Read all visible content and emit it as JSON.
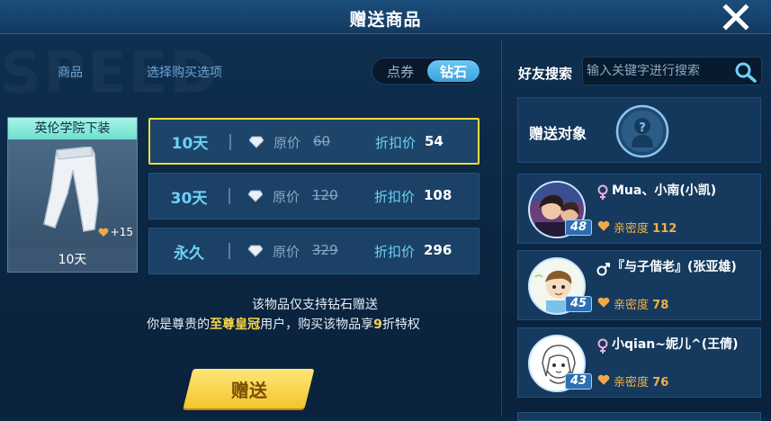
{
  "header": {
    "title": "赠送商品",
    "close_icon": "close-icon"
  },
  "watermark": "SPEED",
  "left": {
    "tabs": {
      "goods": "商品",
      "purchase_options": "选择购买选项"
    },
    "currency": {
      "options": [
        "点券",
        "钻石"
      ],
      "selected": "钻石"
    },
    "item": {
      "name": "英伦学院下装",
      "bonus": "+15",
      "duration": "10天"
    },
    "options": [
      {
        "days": "10天",
        "orig_label": "原价",
        "orig": "60",
        "disc_label": "折扣价",
        "disc": "54",
        "selected": true
      },
      {
        "days": "30天",
        "orig_label": "原价",
        "orig": "120",
        "disc_label": "折扣价",
        "disc": "108",
        "selected": false
      },
      {
        "days": "永久",
        "orig_label": "原价",
        "orig": "329",
        "disc_label": "折扣价",
        "disc": "296",
        "selected": false
      }
    ],
    "notice1": "该物品仅支持钻石赠送",
    "notice2": {
      "pre": "你是尊贵的",
      "highlight": "至尊皇冠",
      "mid": "用户，购买该物品享",
      "num": "9",
      "post": "折特权"
    },
    "send_label": "赠送"
  },
  "right": {
    "search_label": "好友搜索",
    "search_placeholder": "输入关键字进行搜索",
    "target_label": "赠送对象",
    "friends": [
      {
        "name": "Mua、小南(小凯)",
        "level": "48",
        "intimacy_label": "亲密度",
        "intimacy": "112",
        "gender": "female"
      },
      {
        "name": "『与子偕老』(张亚雄)",
        "level": "45",
        "intimacy_label": "亲密度",
        "intimacy": "78",
        "gender": "male"
      },
      {
        "name": "小qian~妮儿^(王倩)",
        "level": "43",
        "intimacy_label": "亲密度",
        "intimacy": "76",
        "gender": "female"
      }
    ]
  },
  "colors": {
    "accent": "#6fd1f5",
    "highlight": "#f6d54a",
    "selected_border": "#f2da3e",
    "button": "#f3c52b"
  }
}
